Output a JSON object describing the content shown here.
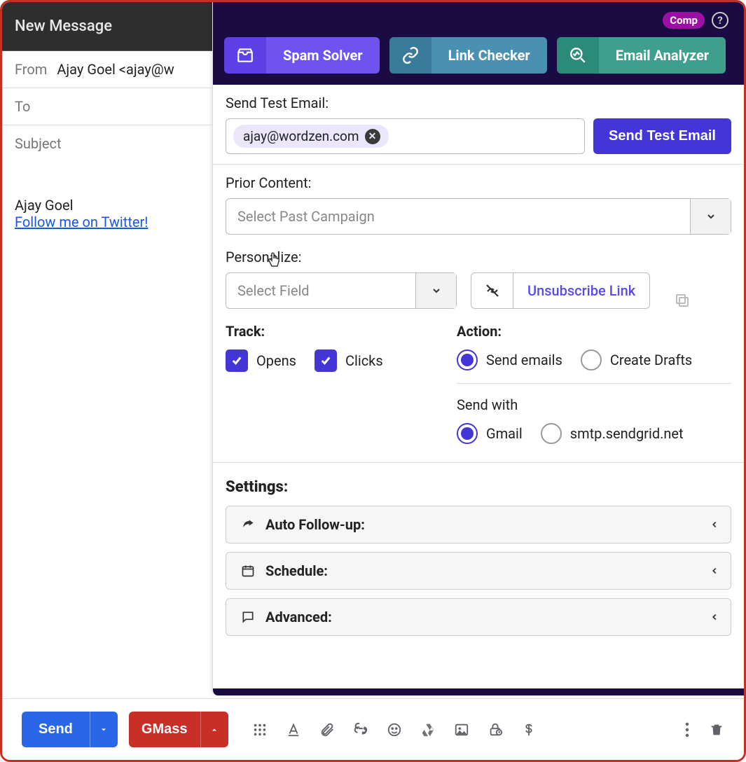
{
  "compose": {
    "title": "New Message",
    "from_label": "From",
    "from_value": "Ajay Goel <ajay@w",
    "to_label": "To",
    "subject_label": "Subject",
    "body_name": "Ajay Goel",
    "body_link": "Follow me on Twitter!"
  },
  "header": {
    "comp": "Comp",
    "spam_solver": "Spam Solver",
    "link_checker": "Link Checker",
    "email_analyzer": "Email Analyzer"
  },
  "panel": {
    "send_test_label": "Send Test Email:",
    "test_chip": "ajay@wordzen.com",
    "send_test_btn": "Send Test Email",
    "prior_content_label": "Prior Content:",
    "prior_content_placeholder": "Select Past Campaign",
    "personalize_label": "Personalize:",
    "personalize_placeholder": "Select Field",
    "unsubscribe": "Unsubscribe Link",
    "track_label": "Track:",
    "opens": "Opens",
    "clicks": "Clicks",
    "action_label": "Action:",
    "send_emails": "Send emails",
    "create_drafts": "Create Drafts",
    "send_with_label": "Send with",
    "gmail": "Gmail",
    "sendgrid": "smtp.sendgrid.net",
    "settings_label": "Settings:",
    "auto_followup": "Auto Follow-up:",
    "schedule": "Schedule:",
    "advanced": "Advanced:"
  },
  "bottom": {
    "send": "Send",
    "gmass": "GMass"
  }
}
